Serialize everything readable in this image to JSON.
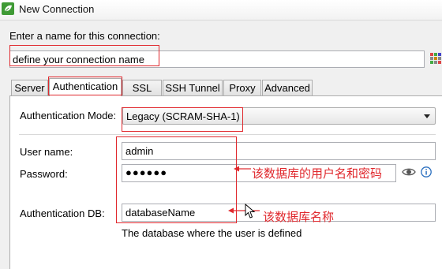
{
  "window": {
    "title": "New Connection",
    "icon": "leaf-app-icon"
  },
  "name_section": {
    "prompt": "Enter a name for this connection:",
    "value": "define your connection name"
  },
  "tabs": [
    {
      "label": "Server"
    },
    {
      "label": "Authentication"
    },
    {
      "label": "SSL"
    },
    {
      "label": "SSH Tunnel"
    },
    {
      "label": "Proxy"
    },
    {
      "label": "Advanced"
    }
  ],
  "active_tab": "Authentication",
  "auth": {
    "mode_label": "Authentication Mode:",
    "mode_value": "Legacy (SCRAM-SHA-1)",
    "username_label": "User name:",
    "username_value": "admin",
    "password_label": "Password:",
    "password_value": "●●●●●●",
    "authdb_label": "Authentication DB:",
    "authdb_value": "databaseName",
    "authdb_hint": "The database where the user is defined"
  },
  "annotations": {
    "credentials": "该数据库的用户名和密码",
    "database": "该数据库名称"
  },
  "colors": {
    "annotation": "#e0282d",
    "accent": "#2a6fbf"
  }
}
